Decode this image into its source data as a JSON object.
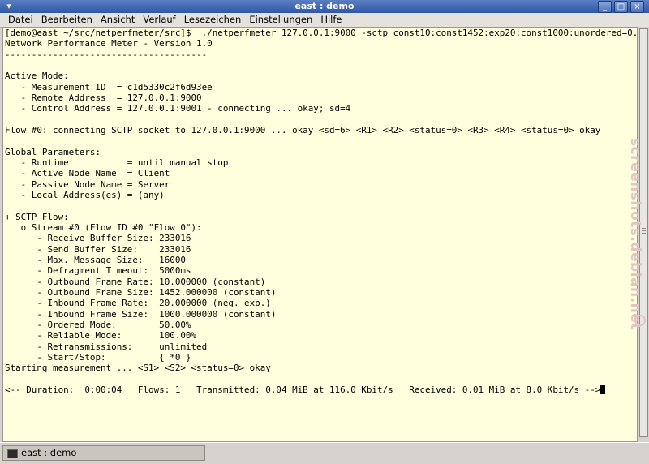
{
  "window": {
    "title": "east : demo",
    "menu_icon": "window-menu-icon",
    "controls": [
      "minimize-icon",
      "maximize-icon",
      "close-icon"
    ]
  },
  "menubar": {
    "items": [
      "Datei",
      "Bearbeiten",
      "Ansicht",
      "Verlauf",
      "Lesezeichen",
      "Einstellungen",
      "Hilfe"
    ]
  },
  "terminal": {
    "lines": [
      "[demo@east ~/src/netperfmeter/src]$  ./netperfmeter 127.0.0.1:9000 -sctp const10:const1452:exp20:const1000:unordered=0.5",
      "Network Performance Meter - Version 1.0",
      "--------------------------------------",
      "",
      "Active Mode:",
      "   - Measurement ID  = c1d5330c2f6d93ee",
      "   - Remote Address  = 127.0.0.1:9000",
      "   - Control Address = 127.0.0.1:9001 - connecting ... okay; sd=4",
      "",
      "Flow #0: connecting SCTP socket to 127.0.0.1:9000 ... okay <sd=6> <R1> <R2> <status=0> <R3> <R4> <status=0> okay",
      "",
      "Global Parameters:",
      "   - Runtime           = until manual stop",
      "   - Active Node Name  = Client",
      "   - Passive Node Name = Server",
      "   - Local Address(es) = (any)",
      "",
      "+ SCTP Flow:",
      "   o Stream #0 (Flow ID #0 \"Flow 0\"):",
      "      - Receive Buffer Size: 233016",
      "      - Send Buffer Size:    233016",
      "      - Max. Message Size:   16000",
      "      - Defragment Timeout:  5000ms",
      "      - Outbound Frame Rate: 10.000000 (constant)",
      "      - Outbound Frame Size: 1452.000000 (constant)",
      "      - Inbound Frame Rate:  20.000000 (neg. exp.)",
      "      - Inbound Frame Size:  1000.000000 (constant)",
      "      - Ordered Mode:        50.00%",
      "      - Reliable Mode:       100.00%",
      "      - Retransmissions:     unlimited",
      "      - Start/Stop:          { *0 }",
      "Starting measurement ... <S1> <S2> <status=0> okay",
      "",
      "<-- Duration:  0:00:04   Flows: 1   Transmitted: 0.04 MiB at 116.0 Kbit/s   Received: 0.01 MiB at 8.0 Kbit/s -->"
    ],
    "background": "#ffffdd",
    "cursor_icon": "text-cursor-icon"
  },
  "watermark": {
    "text": "screenshots.debian.net"
  },
  "taskbar": {
    "item_label": "east : demo",
    "item_icon": "terminal-icon"
  }
}
